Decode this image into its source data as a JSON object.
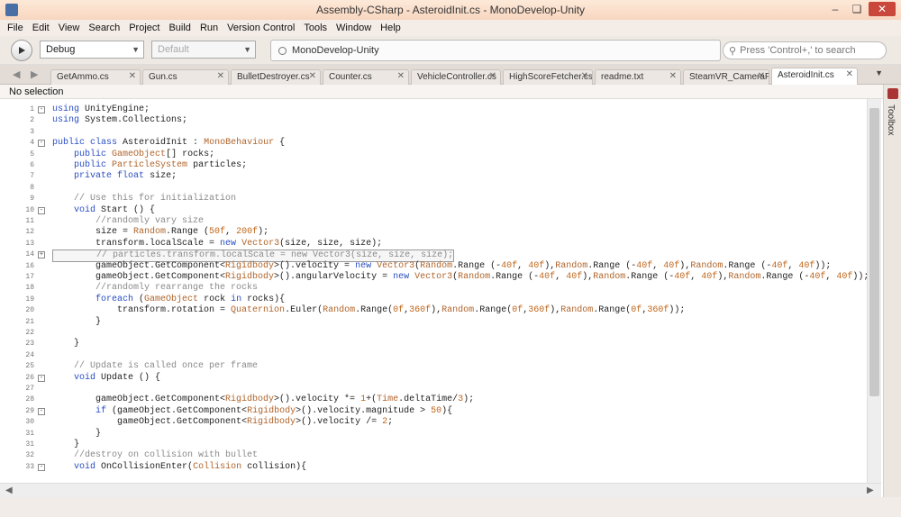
{
  "window": {
    "title": "Assembly-CSharp - AsteroidInit.cs - MonoDevelop-Unity"
  },
  "menu": [
    "File",
    "Edit",
    "View",
    "Search",
    "Project",
    "Build",
    "Run",
    "Version Control",
    "Tools",
    "Window",
    "Help"
  ],
  "toolbar": {
    "config": "Debug",
    "platform": "Default",
    "status": "MonoDevelop-Unity",
    "search_placeholder": "Press 'Control+,' to search"
  },
  "tabs": [
    "GetAmmo.cs",
    "Gun.cs",
    "BulletDestroyer.cs",
    "Counter.cs",
    "VehicleController.cs",
    "HighScoreFetcher.cs",
    "readme.txt",
    "SteamVR_CameraFlip.cs",
    "AsteroidInit.cs"
  ],
  "active_tab": "AsteroidInit.cs",
  "breadcrumb": "No selection",
  "rail_label": "Toolbox",
  "code_lines": [
    {
      "n": "1",
      "fold": "-",
      "text": "using UnityEngine;"
    },
    {
      "n": "2",
      "fold": "",
      "text": "using System.Collections;"
    },
    {
      "n": "3",
      "fold": "",
      "text": ""
    },
    {
      "n": "4",
      "fold": "-",
      "text": "public class AsteroidInit : MonoBehaviour {"
    },
    {
      "n": "5",
      "fold": "",
      "text": "    public GameObject[] rocks;"
    },
    {
      "n": "6",
      "fold": "",
      "text": "    public ParticleSystem particles;"
    },
    {
      "n": "7",
      "fold": "",
      "text": "    private float size;"
    },
    {
      "n": "8",
      "fold": "",
      "text": ""
    },
    {
      "n": "9",
      "fold": "",
      "text": "    // Use this for initialization"
    },
    {
      "n": "10",
      "fold": "-",
      "text": "    void Start () {"
    },
    {
      "n": "11",
      "fold": "",
      "text": "        //randomly vary size"
    },
    {
      "n": "12",
      "fold": "",
      "text": "        size = Random.Range (50f, 200f);"
    },
    {
      "n": "13",
      "fold": "",
      "text": "        transform.localScale = new Vector3(size, size, size);"
    },
    {
      "n": "14",
      "fold": "+",
      "text": "        // particles.transform.localScale = new Vector3(size, size, size);"
    },
    {
      "n": "16",
      "fold": "",
      "text": "        gameObject.GetComponent<Rigidbody>().velocity = new Vector3(Random.Range (-40f, 40f),Random.Range (-40f, 40f),Random.Range (-40f, 40f));"
    },
    {
      "n": "17",
      "fold": "",
      "text": "        gameObject.GetComponent<Rigidbody>().angularVelocity = new Vector3(Random.Range (-40f, 40f),Random.Range (-40f, 40f),Random.Range (-40f, 40f));"
    },
    {
      "n": "18",
      "fold": "",
      "text": "        //randomly rearrange the rocks"
    },
    {
      "n": "19",
      "fold": "",
      "text": "        foreach (GameObject rock in rocks){"
    },
    {
      "n": "20",
      "fold": "",
      "text": "            transform.rotation = Quaternion.Euler(Random.Range(0f,360f),Random.Range(0f,360f),Random.Range(0f,360f));"
    },
    {
      "n": "21",
      "fold": "",
      "text": "        }"
    },
    {
      "n": "22",
      "fold": "",
      "text": ""
    },
    {
      "n": "23",
      "fold": "",
      "text": "    }"
    },
    {
      "n": "24",
      "fold": "",
      "text": ""
    },
    {
      "n": "25",
      "fold": "",
      "text": "    // Update is called once per frame"
    },
    {
      "n": "26",
      "fold": "-",
      "text": "    void Update () {"
    },
    {
      "n": "27",
      "fold": "",
      "text": ""
    },
    {
      "n": "28",
      "fold": "",
      "text": "        gameObject.GetComponent<Rigidbody>().velocity *= 1+(Time.deltaTime/3);"
    },
    {
      "n": "29",
      "fold": "-",
      "text": "        if (gameObject.GetComponent<Rigidbody>().velocity.magnitude > 50){"
    },
    {
      "n": "30",
      "fold": "",
      "text": "            gameObject.GetComponent<Rigidbody>().velocity /= 2;"
    },
    {
      "n": "31",
      "fold": "",
      "text": "        }"
    },
    {
      "n": "31",
      "fold": "",
      "text": "    }"
    },
    {
      "n": "32",
      "fold": "",
      "text": "    //destroy on collision with bullet"
    },
    {
      "n": "33",
      "fold": "-",
      "text": "    void OnCollisionEnter(Collision collision){"
    }
  ]
}
